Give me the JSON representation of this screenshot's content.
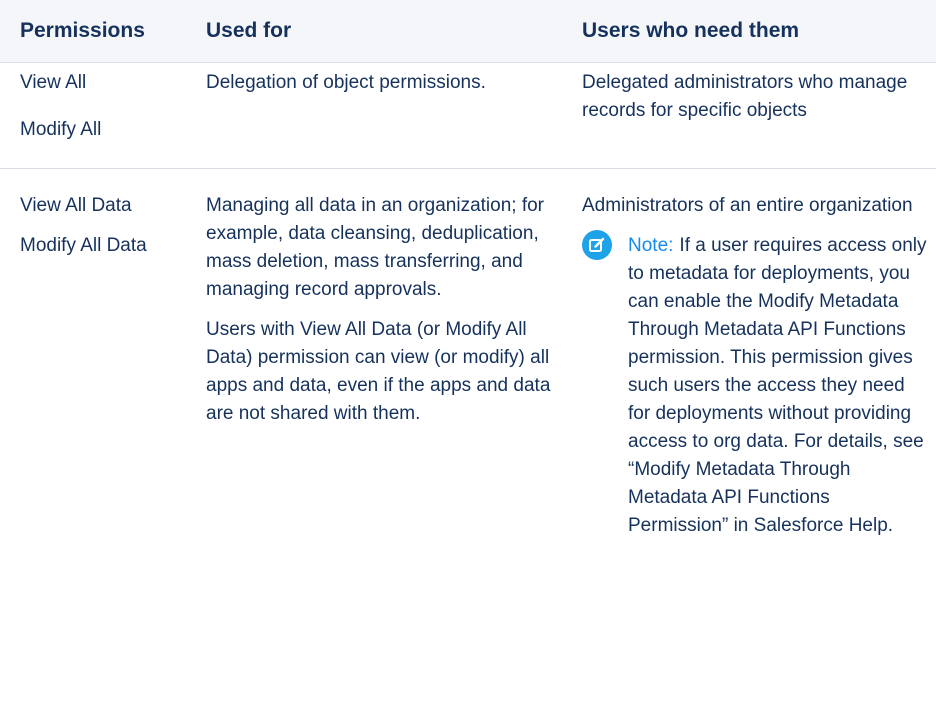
{
  "table": {
    "headers": {
      "permissions": "Permissions",
      "used_for": "Used for",
      "users": "Users who need them"
    },
    "rows": [
      {
        "permissions": [
          "View All",
          "Modify All"
        ],
        "used_for": [
          "Delegation of object permissions."
        ],
        "users": "Delegated administrators who manage records for specific objects"
      },
      {
        "permissions": [
          "View All Data",
          "Modify All Data"
        ],
        "used_for": [
          "Managing all data in an organization; for example, data cleansing, deduplication, mass deletion, mass transferring, and managing record approvals.",
          "Users with View All Data (or Modify All Data) permission can view (or modify) all apps and data, even if the apps and data are not shared with them."
        ],
        "users": "Administrators of an entire organization",
        "note": {
          "icon": "edit-note-icon",
          "label": "Note:",
          "text": "If a user requires access only to metadata for deployments, you can enable the Modify Metadata Through Metadata API Functions permission. This permission gives such users the access they need for deployments without providing access to org data. For details, see “Modify Metadata Through Metadata API Functions Permission” in Salesforce Help."
        }
      }
    ]
  },
  "colors": {
    "text": "#16325c",
    "header_bg": "#f4f6f9",
    "divider": "#d8dde6",
    "note_accent": "#1589ee",
    "note_icon_bg": "#1fa3e8"
  }
}
